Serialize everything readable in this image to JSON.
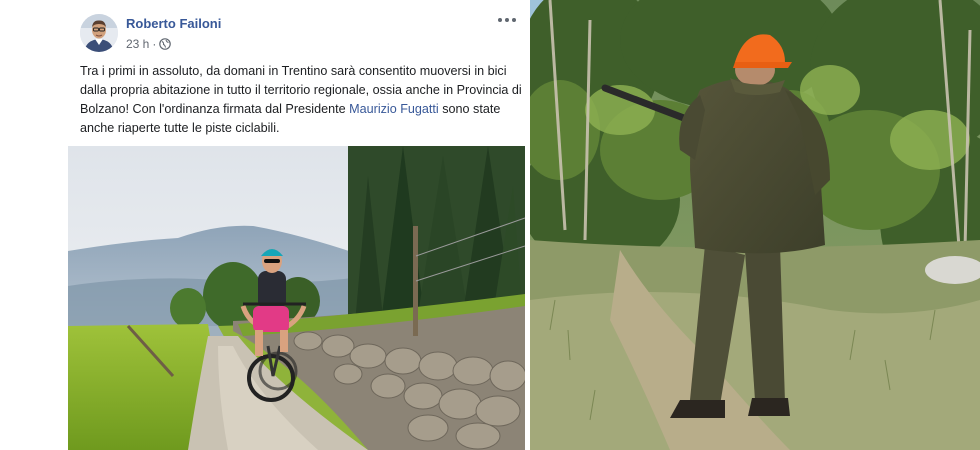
{
  "post": {
    "author": "Roberto Failoni",
    "time": "23 h",
    "separator": "·",
    "audience_icon": "globe-icon",
    "more_icon": "ellipsis-icon",
    "text_before_link": "Tra i primi in assoluto, da domani in Trentino sarà consentito muoversi in bici dalla propria abitazione in tutto il territorio regionale, ossia anche in Provincia di Bolzano! Con l'ordinanza firmata dal Presidente ",
    "link_text": "Maurizio Fugatti",
    "text_after_link": " sono state anche riaperte tutte le piste ciclabili.",
    "link_color": "#385898"
  },
  "images": {
    "post_photo": "cyclist-on-gravel-path-photo",
    "right_photo": "hunter-with-rifle-photo"
  }
}
